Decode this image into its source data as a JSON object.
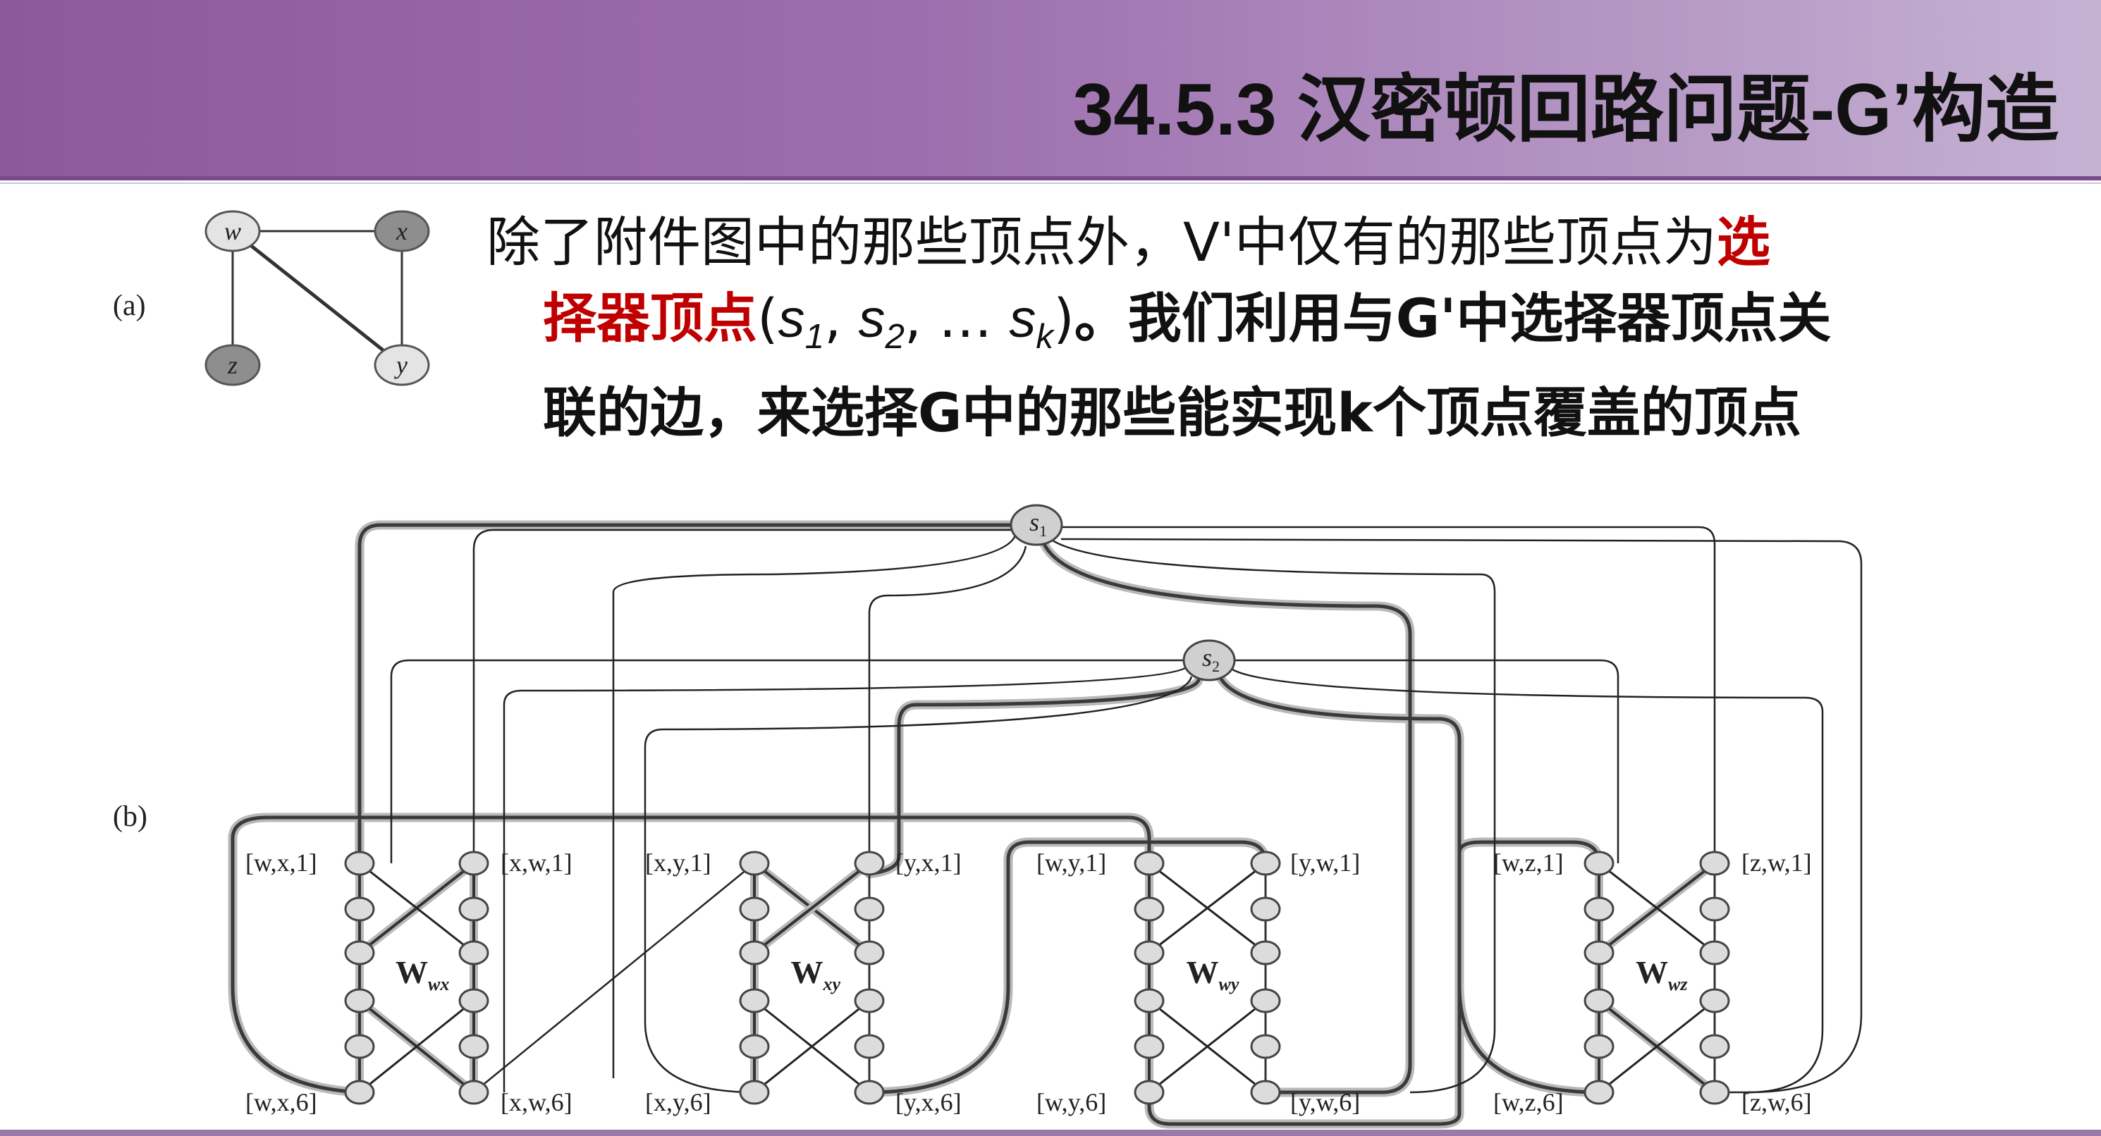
{
  "title": "34.5.3 汉密顿回路问题-G’构造",
  "paragraph": {
    "line1_normal": "除了附件图中的那些顶点外，V'中仅有的那些顶点为",
    "line1_red": "选",
    "line2_red": "择器顶点",
    "line2_math_s1": "s",
    "line2_math_1": "1",
    "line2_sep1": ", ",
    "line2_math_s2": "s",
    "line2_math_2": "2",
    "line2_sep2": ", … ",
    "line2_math_sk": "s",
    "line2_math_k": "k",
    "line2_open": "(",
    "line2_close": ")",
    "line2_rest": "。我们利用与G'中选择器顶点关",
    "line3": "联的边，来选择G中的那些能实现k个顶点覆盖的顶点"
  },
  "panel_a": {
    "label": "(a)",
    "vertices": [
      "w",
      "x",
      "z",
      "y"
    ]
  },
  "panel_b": {
    "label": "(b)",
    "selectors": [
      "s1",
      "s2"
    ],
    "widgets": [
      "Wwx",
      "Wxy",
      "Wwy",
      "Wwz"
    ],
    "top_labels": [
      "[w,x,1]",
      "[x,w,1]",
      "[x,y,1]",
      "[y,x,1]",
      "[w,y,1]",
      "[y,w,1]",
      "[w,z,1]",
      "[z,w,1]"
    ],
    "bottom_labels": [
      "[w,x,6]",
      "[x,w,6]",
      "[x,y,6]",
      "[y,x,6]",
      "[w,y,6]",
      "[y,w,6]",
      "[w,z,6]",
      "[z,w,6]"
    ]
  }
}
